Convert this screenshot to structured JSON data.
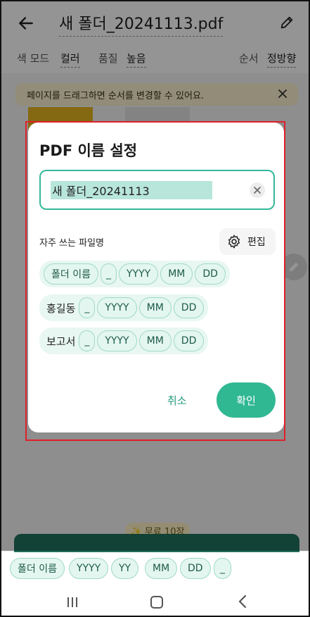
{
  "header": {
    "filename": "새 폴더_20241113.pdf"
  },
  "options": {
    "color_label": "색 모드",
    "color_value": "컬러",
    "quality_label": "품질",
    "quality_value": "높음",
    "order_label": "순서",
    "order_value": "정방향"
  },
  "banner": {
    "text": "페이지를 드래그하면 순서를 변경할 수 있어요."
  },
  "dialog": {
    "title": "PDF 이름 설정",
    "name_value": "새 폴더_20241113",
    "frequent_label": "자주 쓰는 파일명",
    "edit_label": "편집",
    "presets": [
      {
        "tokens": [
          "폴더 이름",
          "_",
          "YYYY",
          "MM",
          "DD"
        ]
      },
      {
        "name": "홍길동",
        "tokens": [
          "_",
          "YYYY",
          "MM",
          "DD"
        ]
      },
      {
        "name": "보고서",
        "tokens": [
          "_",
          "YYYY",
          "MM",
          "DD"
        ]
      }
    ],
    "cancel": "취소",
    "confirm": "확인"
  },
  "promo": {
    "free_label": "✨ 무료 10장"
  },
  "chipbar": {
    "chips": [
      "폴더 이름",
      "YYYY",
      "YY",
      "MM",
      "DD",
      "_"
    ]
  },
  "colors": {
    "accent": "#30b893",
    "accent_dark": "#20705c",
    "chip_bg": "#e3f6ef",
    "highlight": "#e0202a"
  }
}
